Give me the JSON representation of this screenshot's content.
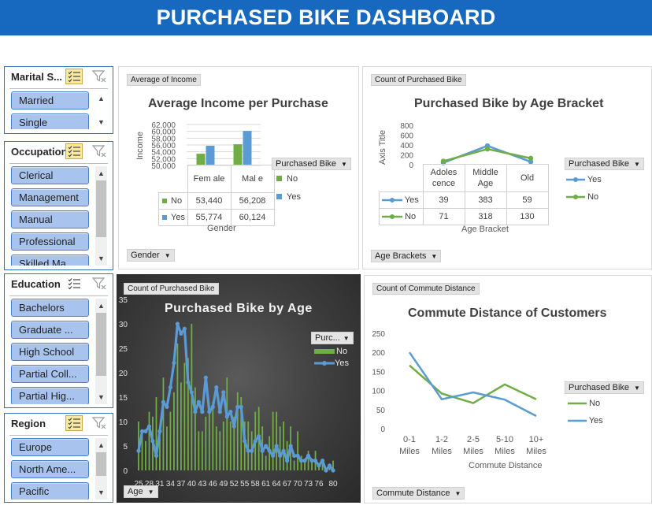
{
  "header": {
    "title": "PURCHASED BIKE DASHBOARD"
  },
  "slicers": {
    "marital": {
      "title": "Marital S...",
      "items": [
        "Married",
        "Single"
      ]
    },
    "occupation": {
      "title": "Occupation",
      "items": [
        "Clerical",
        "Management",
        "Manual",
        "Professional",
        "Skilled Ma..."
      ]
    },
    "education": {
      "title": "Education",
      "items": [
        "Bachelors",
        "Graduate ...",
        "High School",
        "Partial Coll...",
        "Partial Hig..."
      ]
    },
    "region": {
      "title": "Region",
      "items": [
        "Europe",
        "North Ame...",
        "Pacific"
      ]
    }
  },
  "income_chart": {
    "field_button": "Average of Income",
    "axis_button": "Gender",
    "legend_button": "Purchased Bike",
    "title": "Average Income per Purchase",
    "ylabel": "Income",
    "xlabel": "Gender",
    "col_female": "Fem ale",
    "col_male": "Mal e",
    "rows": [
      {
        "label": "No",
        "female": "53,440",
        "male": "56,208"
      },
      {
        "label": "Yes",
        "female": "55,774",
        "male": "60,124"
      }
    ],
    "legend": [
      "No",
      "Yes"
    ]
  },
  "age_bracket_chart": {
    "field_button": "Count of Purchased Bike",
    "axis_button": "Age Brackets",
    "legend_button": "Purchased Bike",
    "title": "Purchased Bike by Age Bracket",
    "ylabel": "Axis Title",
    "xlabel": "Age Bracket",
    "col_1": "Adoles cence",
    "col_2": "Middle Age",
    "col_3": "Old",
    "rows": [
      {
        "label": "Yes",
        "v1": "39",
        "v2": "383",
        "v3": "59"
      },
      {
        "label": "No",
        "v1": "71",
        "v2": "318",
        "v3": "130"
      }
    ],
    "legend": [
      "Yes",
      "No"
    ]
  },
  "age_chart": {
    "field_button": "Count of Purchased Bike",
    "axis_button": "Age",
    "legend_button": "Purc...",
    "title": "Purchased Bike by Age",
    "legend": [
      "No",
      "Yes"
    ]
  },
  "commute_chart": {
    "field_button": "Count of Commute Distance",
    "axis_button": "Commute Distance",
    "legend_button": "Purchased Bike",
    "title": "Commute Distance of Customers",
    "xlabel": "Commute Distance",
    "legend": [
      "No",
      "Yes"
    ]
  },
  "colors": {
    "no": "#70ad47",
    "yes": "#5b9bd5",
    "header": "#1769bf"
  },
  "chart_data": [
    {
      "type": "bar",
      "title": "Average Income per Purchase",
      "xlabel": "Gender",
      "ylabel": "Income",
      "categories": [
        "Female",
        "Male"
      ],
      "series": [
        {
          "name": "No",
          "values": [
            53440,
            56208
          ]
        },
        {
          "name": "Yes",
          "values": [
            55774,
            60124
          ]
        }
      ],
      "ylim": [
        50000,
        62000
      ],
      "yticks": [
        "62,000",
        "60,000",
        "58,000",
        "56,000",
        "54,000",
        "52,000",
        "50,000"
      ]
    },
    {
      "type": "line",
      "title": "Purchased Bike by Age Bracket",
      "xlabel": "Age Bracket",
      "ylabel": "Axis Title",
      "categories": [
        "Adolescence",
        "Middle Age",
        "Old"
      ],
      "series": [
        {
          "name": "Yes",
          "values": [
            39,
            383,
            59
          ]
        },
        {
          "name": "No",
          "values": [
            71,
            318,
            130
          ]
        }
      ],
      "ylim": [
        0,
        800
      ],
      "yticks": [
        "800",
        "600",
        "400",
        "200",
        "0"
      ]
    },
    {
      "type": "line",
      "title": "Purchased Bike by Age",
      "x": [
        25,
        26,
        27,
        28,
        29,
        30,
        31,
        32,
        33,
        34,
        35,
        36,
        37,
        38,
        39,
        40,
        41,
        42,
        43,
        44,
        45,
        46,
        47,
        48,
        49,
        50,
        51,
        52,
        53,
        54,
        55,
        56,
        57,
        58,
        59,
        60,
        61,
        62,
        63,
        64,
        65,
        66,
        67,
        68,
        69,
        70,
        71,
        72,
        73,
        74,
        75,
        76,
        77,
        78,
        79,
        80
      ],
      "xticks": [
        "25",
        "28",
        "31",
        "34",
        "37",
        "40",
        "43",
        "46",
        "49",
        "52",
        "55",
        "58",
        "61",
        "64",
        "67",
        "70",
        "73",
        "76",
        "80"
      ],
      "series": [
        {
          "name": "No",
          "values": [
            10,
            8,
            6,
            12,
            11,
            15,
            7,
            19,
            9,
            12,
            16,
            26,
            18,
            22,
            23,
            30,
            17,
            8,
            8,
            11,
            13,
            14,
            9,
            8,
            10,
            19,
            10,
            11,
            16,
            15,
            10,
            10,
            8,
            12,
            13,
            9,
            3,
            7,
            12,
            12,
            9,
            10,
            6,
            9,
            2,
            8,
            3,
            2,
            4,
            2,
            4,
            1,
            2,
            0,
            1,
            2
          ]
        },
        {
          "name": "Yes",
          "values": [
            4,
            8,
            8,
            9,
            6,
            3,
            8,
            14,
            13,
            17,
            22,
            30,
            28,
            29,
            18,
            16,
            12,
            14,
            12,
            19,
            12,
            13,
            17,
            12,
            16,
            11,
            12,
            9,
            13,
            13,
            6,
            4,
            4,
            6,
            7,
            4,
            5,
            4,
            3,
            5,
            3,
            4,
            2,
            5,
            3,
            3,
            2,
            2,
            3,
            2,
            2,
            1,
            2,
            0,
            1,
            0
          ]
        }
      ],
      "ylim": [
        0,
        35
      ],
      "yticks": [
        "35",
        "30",
        "25",
        "20",
        "15",
        "10",
        "5",
        "0"
      ]
    },
    {
      "type": "line",
      "title": "Commute Distance of Customers",
      "xlabel": "Commute Distance",
      "categories": [
        "0-1 Miles",
        "1-2 Miles",
        "2-5 Miles",
        "5-10 Miles",
        "10+ Miles"
      ],
      "series": [
        {
          "name": "No",
          "values": [
            166,
            92,
            67,
            116,
            77
          ]
        },
        {
          "name": "Yes",
          "values": [
            200,
            77,
            95,
            76,
            33
          ]
        }
      ],
      "ylim": [
        0,
        250
      ],
      "yticks": [
        "250",
        "200",
        "150",
        "100",
        "50",
        "0"
      ]
    }
  ]
}
